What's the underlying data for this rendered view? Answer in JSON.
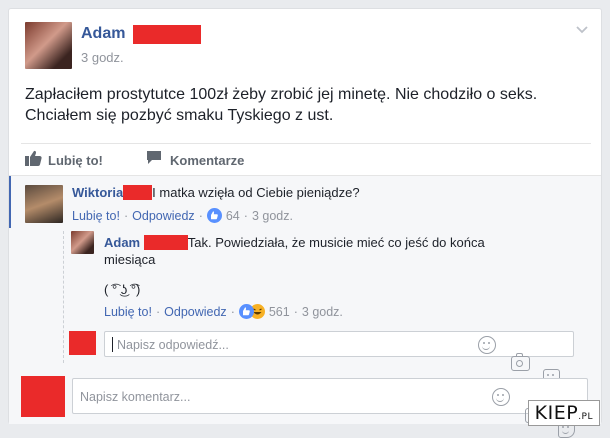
{
  "post": {
    "author": "Adam",
    "time": "3 godz.",
    "text_line1": "Zapłaciłem prostytutce 100zł żeby zrobić jej minetę. Nie chodziło o seks.",
    "text_line2": "Chciałem się pozbyć smaku Tyskiego z ust."
  },
  "actions": {
    "like": "Lubię to!",
    "comment": "Komentarze"
  },
  "comments": [
    {
      "author": "Wiktoria",
      "text": "I matka wzięła od Ciebie pieniądze?",
      "like": "Lubię to!",
      "reply": "Odpowiedz",
      "reaction_count": "64",
      "time": "3 godz."
    },
    {
      "author": "Adam",
      "text_line1": "Tak. Powiedziała, że musicie mieć co jeść do końca",
      "text_line2": "miesiąca",
      "emoticon": "( ͡° ͜ʖ ͡°)",
      "like": "Lubię to!",
      "reply": "Odpowiedz",
      "reaction_count": "561",
      "time": "3 godz."
    }
  ],
  "reply_input": {
    "placeholder": "Napisz odpowiedź..."
  },
  "comment_input": {
    "placeholder": "Napisz komentarz..."
  },
  "watermark": {
    "main": "KIEP",
    "suffix": ".PL"
  },
  "colors": {
    "name": "#365899",
    "link": "#4267b2",
    "censor": "#ea2a2a",
    "like_blue": "#5890ff"
  }
}
